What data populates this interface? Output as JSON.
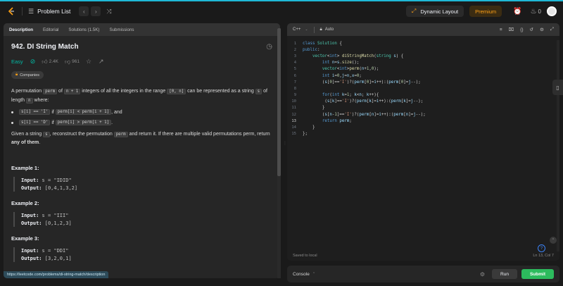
{
  "nav": {
    "title": "Problem List",
    "dynamic_layout": "Dynamic Layout",
    "premium": "Premium",
    "coins": "0"
  },
  "left_tabs": [
    "Description",
    "Editorial",
    "Solutions (1.5K)",
    "Submissions"
  ],
  "problem": {
    "title": "942. DI String Match",
    "difficulty": "Easy",
    "likes": "2.4K",
    "dislikes": "961",
    "companies": "Companies",
    "p1_a": "A permutation ",
    "p1_code1": "perm",
    "p1_b": " of ",
    "p1_code2": "n + 1",
    "p1_c": " integers of all the integers in the range ",
    "p1_code3": "[0, n]",
    "p1_d": " can be represented as a string ",
    "p1_code4": "s",
    "p1_e": " of length ",
    "p1_code5": "n",
    "p1_f": " where:",
    "bullet1_code1": "s[i] == 'I'",
    "bullet1_mid": " if ",
    "bullet1_code2": "perm[i] < perm[i + 1]",
    "bullet1_end": ", and",
    "bullet2_code1": "s[i] == 'D'",
    "bullet2_mid": " if ",
    "bullet2_code2": "perm[i] > perm[i + 1]",
    "bullet2_end": ".",
    "p2_a": "Given a string ",
    "p2_code1": "s",
    "p2_b": ", reconstruct the permutation ",
    "p2_code2": "perm",
    "p2_c": " and return it. If there are multiple valid permutations perm, return ",
    "p2_bold": "any of them",
    "p2_d": "."
  },
  "examples": [
    {
      "heading": "Example 1:",
      "input_label": "Input:",
      "input": " s = \"IDID\"",
      "output_label": "Output:",
      "output": " [0,4,1,3,2]"
    },
    {
      "heading": "Example 2:",
      "input_label": "Input:",
      "input": " s = \"III\"",
      "output_label": "Output:",
      "output": " [0,1,2,3]"
    },
    {
      "heading": "Example 3:",
      "input_label": "Input:",
      "input": " s = \"DDI\"",
      "output_label": "Output:",
      "output": " [3,2,0,1]"
    }
  ],
  "status_url": "https://leetcode.com/problems/di-string-match/description",
  "editor": {
    "language": "C++",
    "mode": "Auto",
    "saved": "Saved to local",
    "cursor": "Ln 13, Col 7"
  },
  "code_lines": [
    "1",
    "2",
    "3",
    "4",
    "5",
    "6",
    "7",
    "8",
    "9",
    "10",
    "11",
    "12",
    "13",
    "14",
    "15"
  ],
  "console": {
    "label": "Console",
    "run": "Run",
    "submit": "Submit"
  }
}
